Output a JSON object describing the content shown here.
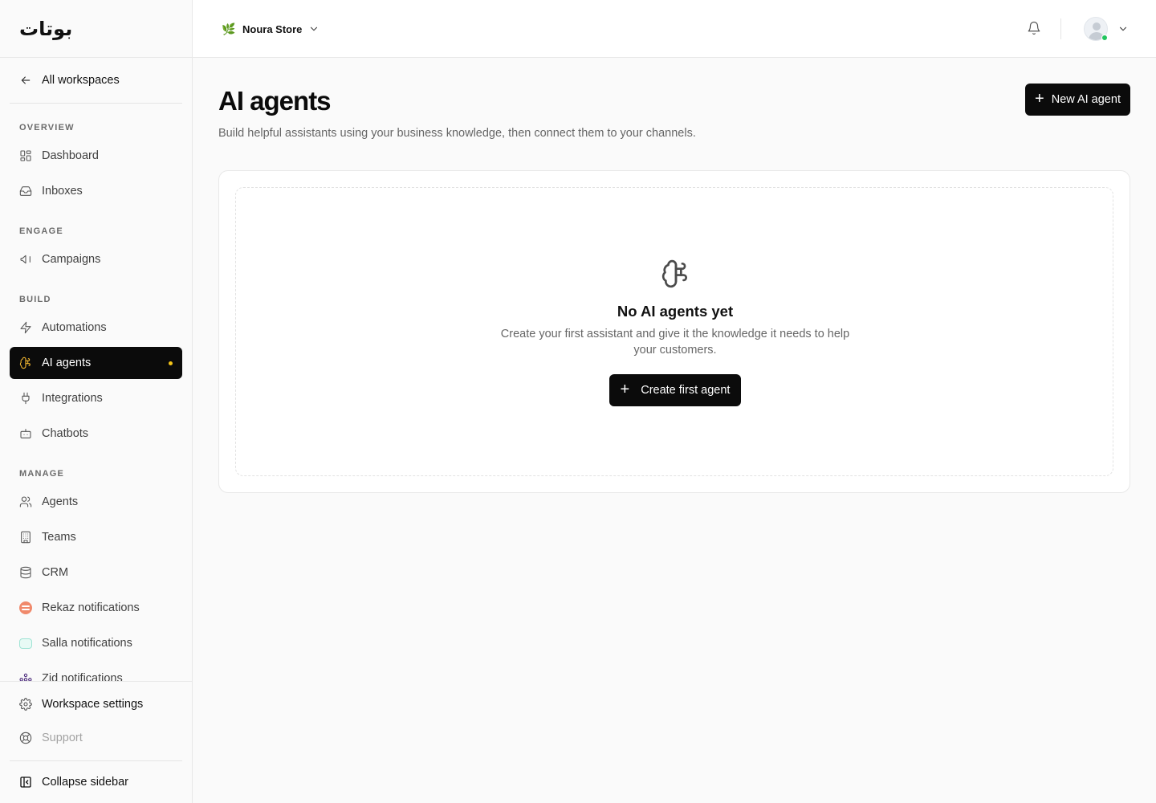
{
  "brand": {
    "logo_text": "بوتات"
  },
  "sidebar": {
    "back_label": "All workspaces",
    "sections": {
      "overview": "OVERVIEW",
      "engage": "ENGAGE",
      "build": "BUILD",
      "manage": "MANAGE"
    },
    "items": {
      "dashboard": "Dashboard",
      "inboxes": "Inboxes",
      "campaigns": "Campaigns",
      "automations": "Automations",
      "ai_agents": "AI agents",
      "integrations": "Integrations",
      "chatbots": "Chatbots",
      "agents": "Agents",
      "teams": "Teams",
      "crm": "CRM",
      "rekaz": "Rekaz notifications",
      "salla": "Salla notifications",
      "zid": "Zid notifications"
    },
    "footer": {
      "workspace_settings": "Workspace settings",
      "support": "Support",
      "collapse": "Collapse sidebar"
    },
    "active_item": "ai_agents",
    "active_accent": "#f2b731"
  },
  "topbar": {
    "workspace_emoji": "🌿",
    "workspace_name": "Noura Store",
    "status_color": "#22c55e"
  },
  "main": {
    "title": "AI agents",
    "subtitle": "Build helpful assistants using your business knowledge, then connect them to your channels.",
    "new_button": "New AI agent",
    "empty_state": {
      "icon": "brain-icon",
      "title": "No AI agents yet",
      "description": "Create your first assistant and give it the knowledge it needs to help your customers.",
      "button": "Create first agent"
    }
  }
}
